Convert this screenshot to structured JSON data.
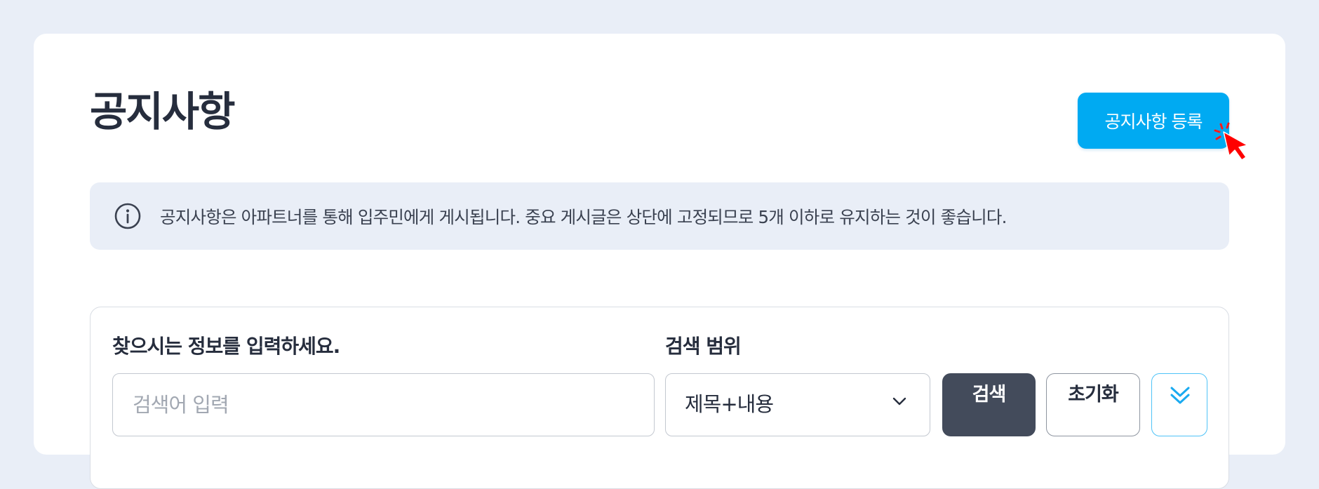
{
  "header": {
    "title": "공지사항",
    "register_button": "공지사항 등록"
  },
  "info": {
    "icon": "info-circle-icon",
    "text": "공지사항은 아파트너를 통해 입주민에게 게시됩니다. 중요 게시글은 상단에 고정되므로 5개 이하로 유지하는 것이 좋습니다."
  },
  "search": {
    "keyword_label": "찾으시는 정보를 입력하세요.",
    "keyword_placeholder": "검색어 입력",
    "keyword_value": "",
    "scope_label": "검색 범위",
    "scope_value": "제목+내용",
    "search_button": "검색",
    "reset_button": "초기화",
    "expand_icon": "double-chevron-down-icon"
  },
  "colors": {
    "background": "#e9eef7",
    "primary": "#00aaf2",
    "dark_button": "#434b5b",
    "cursor": "#ff0000"
  }
}
